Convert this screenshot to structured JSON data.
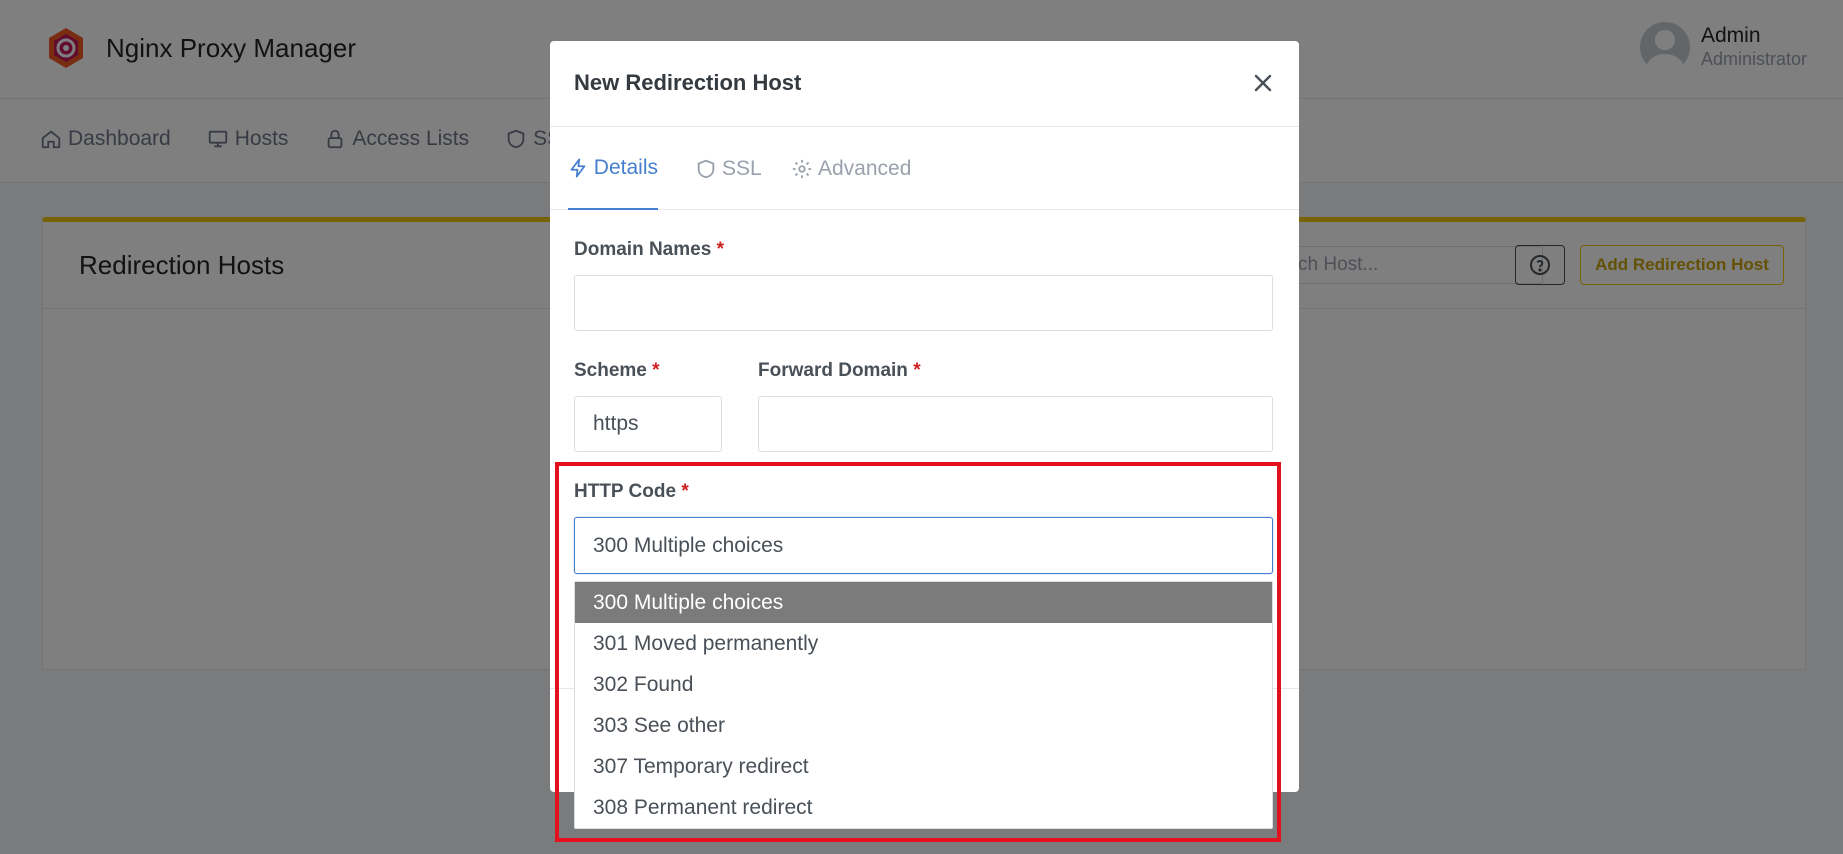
{
  "app": {
    "title": "Nginx Proxy Manager",
    "user": {
      "name": "Admin",
      "role": "Administrator"
    },
    "nav": [
      {
        "label": "Dashboard",
        "icon": "home-icon"
      },
      {
        "label": "Hosts",
        "icon": "monitor-icon"
      },
      {
        "label": "Access Lists",
        "icon": "lock-icon"
      },
      {
        "label": "SSL",
        "icon": "shield-icon"
      }
    ],
    "card": {
      "title": "Redirection Hosts",
      "search_placeholder": "ch Host...",
      "add_label": "Add Redirection Host",
      "accent_color": "#f1c40f"
    }
  },
  "modal": {
    "title": "New Redirection Host",
    "tabs": [
      {
        "label": "Details",
        "icon": "lightning-icon",
        "active": true
      },
      {
        "label": "SSL",
        "icon": "shield-icon",
        "active": false
      },
      {
        "label": "Advanced",
        "icon": "gear-icon",
        "active": false
      }
    ],
    "fields": {
      "domain_names": {
        "label": "Domain Names",
        "value": ""
      },
      "scheme": {
        "label": "Scheme",
        "value": "https"
      },
      "forward_domain": {
        "label": "Forward Domain",
        "value": ""
      },
      "http_code": {
        "label": "HTTP Code",
        "value": "300 Multiple choices",
        "options": [
          "300 Multiple choices",
          "301 Moved permanently",
          "302 Found",
          "303 See other",
          "307 Temporary redirect",
          "308 Permanent redirect"
        ]
      }
    },
    "required_mark": "*"
  },
  "colors": {
    "primary": "#467fcf",
    "required": "#cd201f",
    "highlight": "#e3101e",
    "selected_option": "#7b7b7b"
  }
}
